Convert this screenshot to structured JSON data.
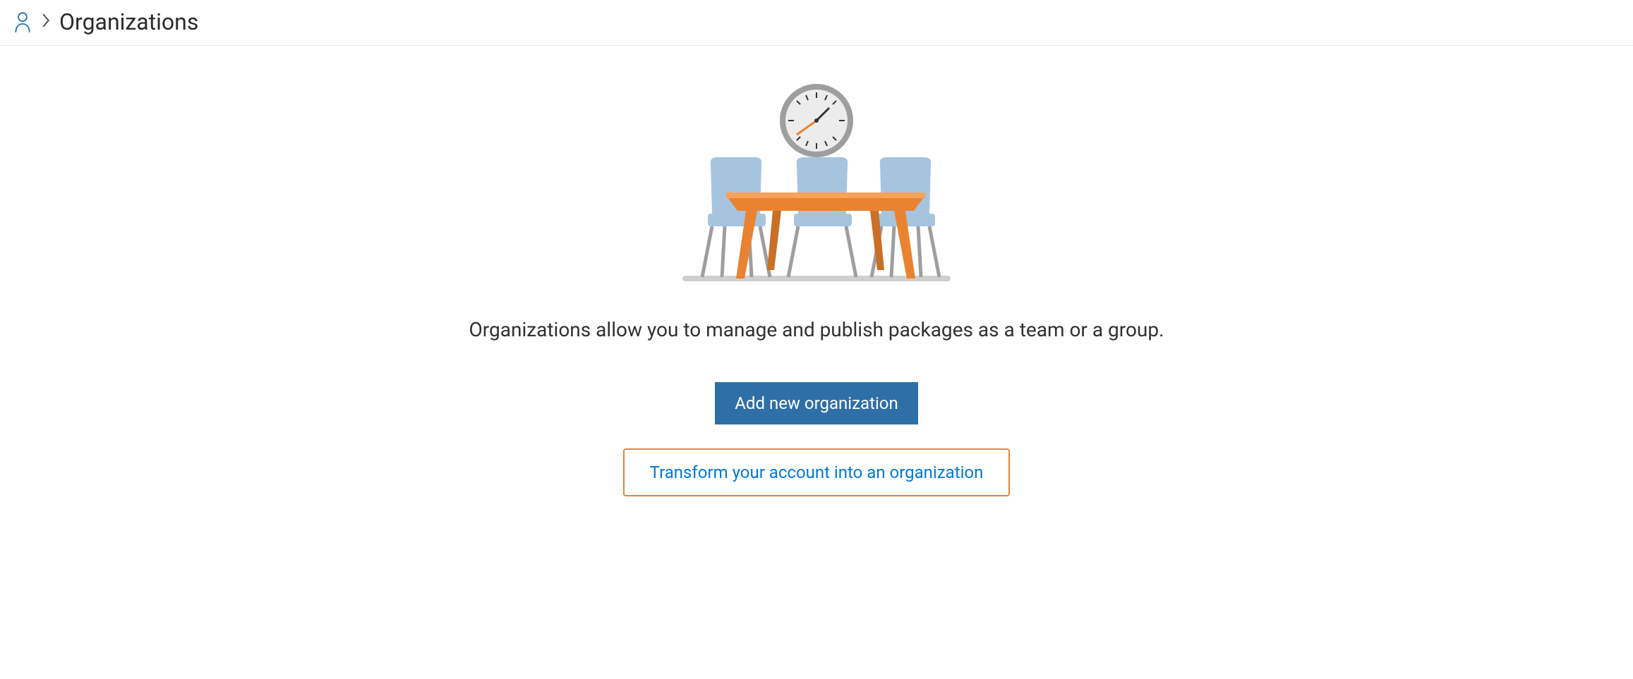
{
  "breadcrumb": {
    "title": "Organizations"
  },
  "main": {
    "description": "Organizations allow you to manage and publish packages as a team or a group.",
    "add_button_label": "Add new organization",
    "transform_button_label": "Transform your account into an organization"
  }
}
